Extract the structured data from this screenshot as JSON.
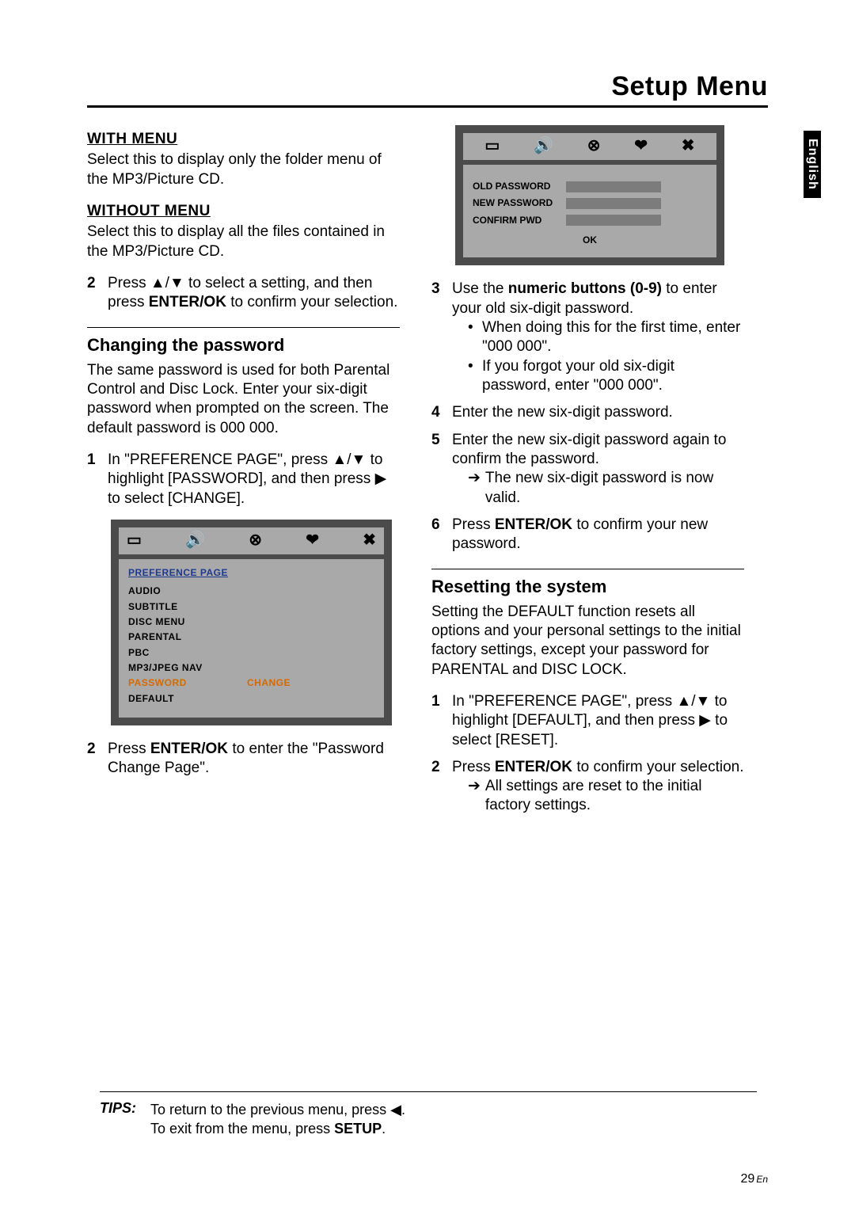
{
  "page_title": "Setup Menu",
  "side_tab": "English",
  "page_number": {
    "num": "29",
    "lang": "En"
  },
  "left": {
    "with_menu": {
      "heading": "WITH MENU",
      "text": "Select this to display only the folder menu of the MP3/Picture CD."
    },
    "without_menu": {
      "heading": "WITHOUT MENU",
      "text": "Select this to display all the files contained in the MP3/Picture CD."
    },
    "step2": {
      "num": "2",
      "a": "Press ",
      "b": " to select a setting, and then press ",
      "enter": "ENTER/OK",
      "c": " to confirm your selection."
    },
    "changing": {
      "heading": "Changing the password",
      "para": "The same password is used for both Parental Control and Disc Lock. Enter your six-digit password when prompted on the screen. The default password is 000 000."
    },
    "c_step1": {
      "num": "1",
      "a": "In \"PREFERENCE PAGE\", press ",
      "b": " to highlight [PASSWORD], and then press ",
      "c": " to select [CHANGE]."
    },
    "osd": {
      "title": "PREFERENCE PAGE",
      "rows": [
        {
          "l": "AUDIO",
          "r": ""
        },
        {
          "l": "SUBTITLE",
          "r": ""
        },
        {
          "l": "DISC MENU",
          "r": ""
        },
        {
          "l": "PARENTAL",
          "r": ""
        },
        {
          "l": "PBC",
          "r": ""
        },
        {
          "l": "MP3/JPEG NAV",
          "r": ""
        },
        {
          "l": "PASSWORD",
          "r": "CHANGE",
          "sel": true
        },
        {
          "l": "DEFAULT",
          "r": ""
        }
      ]
    },
    "c_step2": {
      "num": "2",
      "a": "Press ",
      "enter": "ENTER/OK",
      "b": " to enter the \"Password Change Page\"."
    }
  },
  "right": {
    "osd2": {
      "rows": [
        {
          "lbl": "OLD PASSWORD"
        },
        {
          "lbl": "NEW PASSWORD"
        },
        {
          "lbl": "CONFIRM PWD"
        }
      ],
      "ok": "OK"
    },
    "step3": {
      "num": "3",
      "a": "Use the ",
      "bold": "numeric buttons (0-9)",
      "b": " to enter your old six-digit password."
    },
    "step3_b1": "When doing this for the first time, enter \"000 000\".",
    "step3_b2": "If you forgot your old six-digit password, enter \"000 000\".",
    "step4": {
      "num": "4",
      "t": "Enter the new six-digit password."
    },
    "step5": {
      "num": "5",
      "t": "Enter the new six-digit password again to confirm the password.",
      "arrow": "The new six-digit password is now valid."
    },
    "step6": {
      "num": "6",
      "a": "Press ",
      "enter": "ENTER/OK",
      "b": " to confirm your new password."
    },
    "reset": {
      "heading": "Resetting the system",
      "para": "Setting the DEFAULT function resets all options and your personal settings to the initial factory settings, except your password for PARENTAL and DISC LOCK."
    },
    "r_step1": {
      "num": "1",
      "a": "In \"PREFERENCE PAGE\", press ",
      "b": " to highlight [DEFAULT], and then press ",
      "c": " to select [RESET]."
    },
    "r_step2": {
      "num": "2",
      "a": "Press ",
      "enter": "ENTER/OK",
      "b": " to confirm your selection.",
      "arrow": "All settings are reset to the initial factory settings."
    }
  },
  "tips": {
    "label": "TIPS:",
    "line1a": "To return to the previous menu, press ",
    "line1b": ".",
    "line2a": "To exit from the menu, press ",
    "setup": "SETUP",
    "line2b": "."
  }
}
